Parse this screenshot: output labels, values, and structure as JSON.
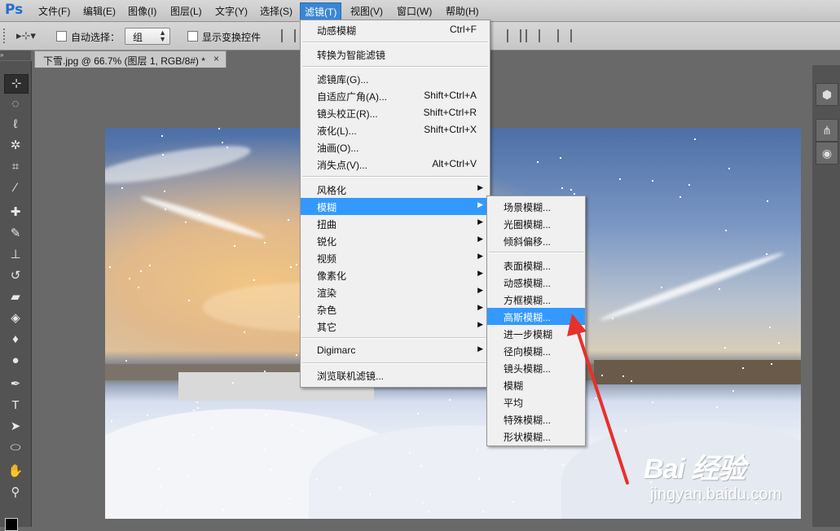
{
  "app": {
    "logo": "Ps"
  },
  "menubar": {
    "items": [
      "文件(F)",
      "编辑(E)",
      "图像(I)",
      "图层(L)",
      "文字(Y)",
      "选择(S)",
      "滤镜(T)",
      "视图(V)",
      "窗口(W)",
      "帮助(H)"
    ]
  },
  "options": {
    "tool_preset": "▸⊹▾",
    "auto_select_label": "自动选择：",
    "auto_select_value": "组",
    "show_transform_label": "显示变换控件"
  },
  "document": {
    "tab_title": "下雪.jpg @ 66.7% (图层 1, RGB/8#) *",
    "close": "×"
  },
  "panel_grip": "»",
  "filter_menu": {
    "last_filter": {
      "label": "动感模糊",
      "shortcut": "Ctrl+F"
    },
    "convert_smart": "转换为智能滤镜",
    "group1": [
      {
        "label": "滤镜库(G)...",
        "shortcut": ""
      },
      {
        "label": "自适应广角(A)...",
        "shortcut": "Shift+Ctrl+A"
      },
      {
        "label": "镜头校正(R)...",
        "shortcut": "Shift+Ctrl+R"
      },
      {
        "label": "液化(L)...",
        "shortcut": "Shift+Ctrl+X"
      },
      {
        "label": "油画(O)...",
        "shortcut": ""
      },
      {
        "label": "消失点(V)...",
        "shortcut": "Alt+Ctrl+V"
      }
    ],
    "submenus": [
      "风格化",
      "模糊",
      "扭曲",
      "锐化",
      "视频",
      "像素化",
      "渲染",
      "杂色",
      "其它"
    ],
    "digimarc": "Digimarc",
    "browse_online": "浏览联机滤镜...",
    "highlighted": "模糊"
  },
  "blur_submenu": {
    "group1": [
      "场景模糊...",
      "光圈模糊...",
      "倾斜偏移..."
    ],
    "group2": [
      "表面模糊...",
      "动感模糊...",
      "方框模糊...",
      "高斯模糊...",
      "进一步模糊",
      "径向模糊...",
      "镜头模糊...",
      "模糊",
      "平均",
      "特殊模糊...",
      "形状模糊..."
    ],
    "highlighted": "高斯模糊..."
  },
  "watermark": {
    "main": "Bai 经验",
    "sub": "jingyan.baidu.com"
  },
  "colors": {
    "menu_highlight": "#3399ff",
    "arrow": "#e8302a",
    "workspace": "#696969"
  }
}
